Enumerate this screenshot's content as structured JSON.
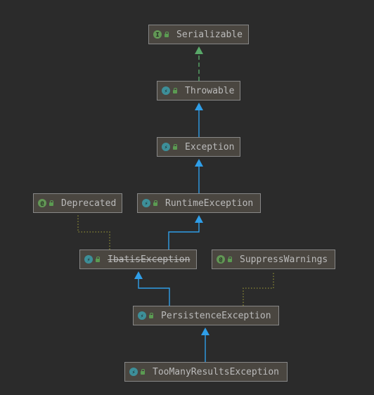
{
  "nodes": [
    {
      "id": "serializable",
      "label": "Serializable",
      "kind": "interface",
      "kind_glyph": "I",
      "deprecated": false
    },
    {
      "id": "throwable",
      "label": "Throwable",
      "kind": "class",
      "kind_glyph": "⚡",
      "deprecated": false
    },
    {
      "id": "exception",
      "label": "Exception",
      "kind": "class",
      "kind_glyph": "⚡",
      "deprecated": false
    },
    {
      "id": "deprecated",
      "label": "Deprecated",
      "kind": "annotation",
      "kind_glyph": "@",
      "deprecated": false
    },
    {
      "id": "runtimeexception",
      "label": "RuntimeException",
      "kind": "class",
      "kind_glyph": "⚡",
      "deprecated": false
    },
    {
      "id": "ibatisexception",
      "label": "IbatisException",
      "kind": "class",
      "kind_glyph": "⚡",
      "deprecated": true
    },
    {
      "id": "suppresswarnings",
      "label": "SuppressWarnings",
      "kind": "annotation",
      "kind_glyph": "@",
      "deprecated": false
    },
    {
      "id": "persistenceexception",
      "label": "PersistenceException",
      "kind": "class",
      "kind_glyph": "⚡",
      "deprecated": false
    },
    {
      "id": "toomanyresultsexception",
      "label": "TooManyResultsException",
      "kind": "class",
      "kind_glyph": "⚡",
      "deprecated": false
    }
  ],
  "edges": [
    {
      "from": "throwable",
      "to": "serializable",
      "type": "implements"
    },
    {
      "from": "exception",
      "to": "throwable",
      "type": "extends"
    },
    {
      "from": "runtimeexception",
      "to": "exception",
      "type": "extends"
    },
    {
      "from": "ibatisexception",
      "to": "runtimeexception",
      "type": "extends"
    },
    {
      "from": "ibatisexception",
      "to": "deprecated",
      "type": "annotated"
    },
    {
      "from": "persistenceexception",
      "to": "ibatisexception",
      "type": "extends"
    },
    {
      "from": "persistenceexception",
      "to": "suppresswarnings",
      "type": "annotated"
    },
    {
      "from": "toomanyresultsexception",
      "to": "persistenceexception",
      "type": "extends"
    }
  ],
  "colors": {
    "background": "#2b2b2b",
    "extends": "#2f9ee8",
    "implements": "#59a869",
    "annotated": "#8c8a35"
  }
}
